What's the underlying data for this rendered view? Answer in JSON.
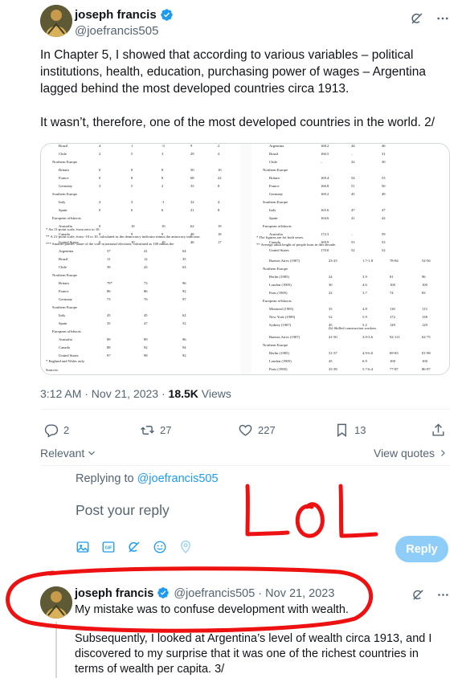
{
  "tweet": {
    "author": {
      "display_name": "joseph francis",
      "handle": "@joefrancis505"
    },
    "text": "In Chapter 5, I showed that according to various variables – political institutions, health, education, purchasing power of wages – Argentina lagged behind the most developed countries circa 1913.\n\nIt wasn’t, therefore, one of the most developed countries in the world. 2/",
    "timestamp": "3:12 AM · Nov 21, 2023 · ",
    "views_count": "18.5K",
    "views_label": " Views",
    "stats": {
      "replies": "2",
      "reposts": "27",
      "likes": "227",
      "bookmarks": "13"
    }
  },
  "media": {
    "left_rows": [
      [
        "Brazil",
        "4",
        "1",
        "-3",
        "9",
        "2"
      ],
      [
        "Chile",
        "2",
        "5",
        "3",
        "29",
        "4"
      ],
      [
        "Northern Europe",
        "",
        "",
        "",
        "",
        ""
      ],
      [
        "Britain",
        "0",
        "8",
        "8",
        "50",
        "10"
      ],
      [
        "France",
        "0",
        "8",
        "8",
        "68",
        "22"
      ],
      [
        "Germany",
        "3",
        "5",
        "2",
        "35",
        "8"
      ],
      [
        "Southern Europe",
        "",
        "",
        "",
        "",
        ""
      ],
      [
        "Italy",
        "4",
        "3",
        "-1",
        "32",
        "4"
      ],
      [
        "Spain",
        "0",
        "6",
        "6",
        "21",
        "8"
      ],
      [
        "European offshoots",
        "",
        "",
        "",
        "",
        ""
      ],
      [
        "Australia",
        "0",
        "10",
        "10",
        "62",
        "19"
      ],
      [
        "Canada",
        "0",
        "9",
        "9",
        "48",
        "18"
      ],
      [
        "United States",
        "0",
        "10",
        "10",
        "46",
        "17"
      ]
    ],
    "left_notes": [
      "* An 11-point scale, from zero to 10.",
      "** A 21-point scale, from -10 to 10, calculated as the democracy indicator minus the autocracy indicator.",
      "*** Smaller parties' share of the vote in national elections, calculated as 100 minus the"
    ],
    "left_rows2": [
      [
        "Argentina",
        "37",
        "41",
        "64"
      ],
      [
        "Brazil",
        "11",
        "12",
        "35"
      ],
      [
        "Chile",
        "39",
        "43",
        "63"
      ],
      [
        "Northern Europe",
        "",
        "",
        ""
      ],
      [
        "Britain",
        "79*",
        "73",
        "96"
      ],
      [
        "France",
        "86",
        "86",
        "92"
      ],
      [
        "Germany",
        "73",
        "76",
        "97"
      ],
      [
        "Southern Europe",
        "",
        "",
        ""
      ],
      [
        "Italy",
        "45",
        "45",
        "62"
      ],
      [
        "Spain",
        "35",
        "47",
        "52"
      ],
      [
        "European offshoots",
        "",
        "",
        ""
      ],
      [
        "Australia",
        "89",
        "89",
        "96"
      ],
      [
        "Canada",
        "88",
        "92",
        "94"
      ],
      [
        "United States",
        "97",
        "98",
        "92"
      ]
    ],
    "left_footer": [
      "* England and Wales only.",
      "Sources:"
    ],
    "right_rows": [
      [
        "Argentina",
        "168.2",
        "44",
        "46"
      ],
      [
        "Brazil",
        "166.5",
        "..",
        "31"
      ],
      [
        "Chile",
        "..",
        "32",
        "30"
      ],
      [
        "Northern Europe",
        "",
        "",
        ""
      ],
      [
        "Britain",
        "169.4",
        "54",
        "53"
      ],
      [
        "France",
        "166.8",
        "51",
        "50"
      ],
      [
        "Germany",
        "169.2",
        "45",
        "49"
      ],
      [
        "Southern Europe",
        "",
        "",
        ""
      ],
      [
        "Italy",
        "165.6",
        "47",
        "47"
      ],
      [
        "Spain",
        "164.6",
        "41",
        "42"
      ],
      [
        "European offshoots",
        "",
        "",
        ""
      ],
      [
        "Australia",
        "172.3",
        "..",
        "59"
      ],
      [
        "Canada",
        "169.9",
        "53",
        "53"
      ],
      [
        "United States",
        "170.0",
        "52",
        "52"
      ]
    ],
    "right_notes": [
      "* The figures are for both sexes.",
      "** Average adult height of people born in this decade."
    ],
    "right_rows2": [
      [
        "Buenos Aires (1907)",
        "23-25",
        "1.7-1.8",
        "78-84",
        "52-56"
      ],
      [
        "Northern Europe",
        "",
        "",
        "",
        ""
      ],
      [
        "Berlin (1905)",
        "24",
        "3.9",
        "81",
        "96"
      ],
      [
        "London (1905)",
        "30",
        "4.6",
        "100",
        "100"
      ],
      [
        "Paris (1905)",
        "22",
        "3.7",
        "74",
        "83"
      ],
      [
        "European offshoots",
        "",
        "",
        "",
        ""
      ],
      [
        "Montreal (1905)",
        "35",
        "4.8",
        "118",
        "113"
      ],
      [
        "New York (1909)",
        "52",
        "5.9",
        "172",
        "138"
      ],
      [
        "Sydney (1907)",
        "45",
        "5.2",
        "149",
        "129"
      ]
    ],
    "right_caption": "(b) Skilled construction workers",
    "right_rows3": [
      [
        "Buenos Aires (1907)",
        "41-50",
        "3.0-3.6",
        "92-111",
        "62-75"
      ],
      [
        "Northern Europe",
        "",
        "",
        "",
        ""
      ],
      [
        "Berlin (1905)",
        "31-37",
        "4.9-6.0",
        "69-83",
        "81-98"
      ],
      [
        "London (1905)",
        "45",
        "6.9",
        "100",
        "100"
      ],
      [
        "Paris (1905)",
        "35-39",
        "5.7-6.4",
        "77-87",
        "86-97"
      ],
      [
        "European offshoots",
        "",
        "",
        "",
        ""
      ],
      [
        "Montreal (1905)",
        "52-86",
        "7.1-11.6",
        "116-91",
        "111-82"
      ]
    ]
  },
  "labels": {
    "relevant": "Relevant",
    "view_quotes": "View quotes",
    "replying_prefix": "Replying to ",
    "replying_handle": "@joefrancis505",
    "reply_placeholder": "Post your reply",
    "reply_button": "Reply"
  },
  "annotation": {
    "text": "LOL",
    "color": "#ee1111"
  },
  "reply_tweet": {
    "display_name": "joseph francis",
    "meta": "@joefrancis505 · Nov 21, 2023",
    "line1": "My mistake was to confuse development with wealth.",
    "line2": "Subsequently, I looked at Argentina’s level of wealth circa 1913, and I discovered to my surprise that it was one of the richest countries in terms of wealth per capita. 3/"
  },
  "colors": {
    "accent": "#1d9bf0",
    "reply_button": "#8ecdf8",
    "muted": "#536471"
  },
  "icons": [
    "verified-icon",
    "grok-icon",
    "more-icon",
    "reply-icon",
    "repost-icon",
    "like-icon",
    "bookmark-icon",
    "share-icon",
    "image-icon",
    "gif-icon",
    "grok-icon",
    "emoji-icon",
    "location-icon"
  ]
}
